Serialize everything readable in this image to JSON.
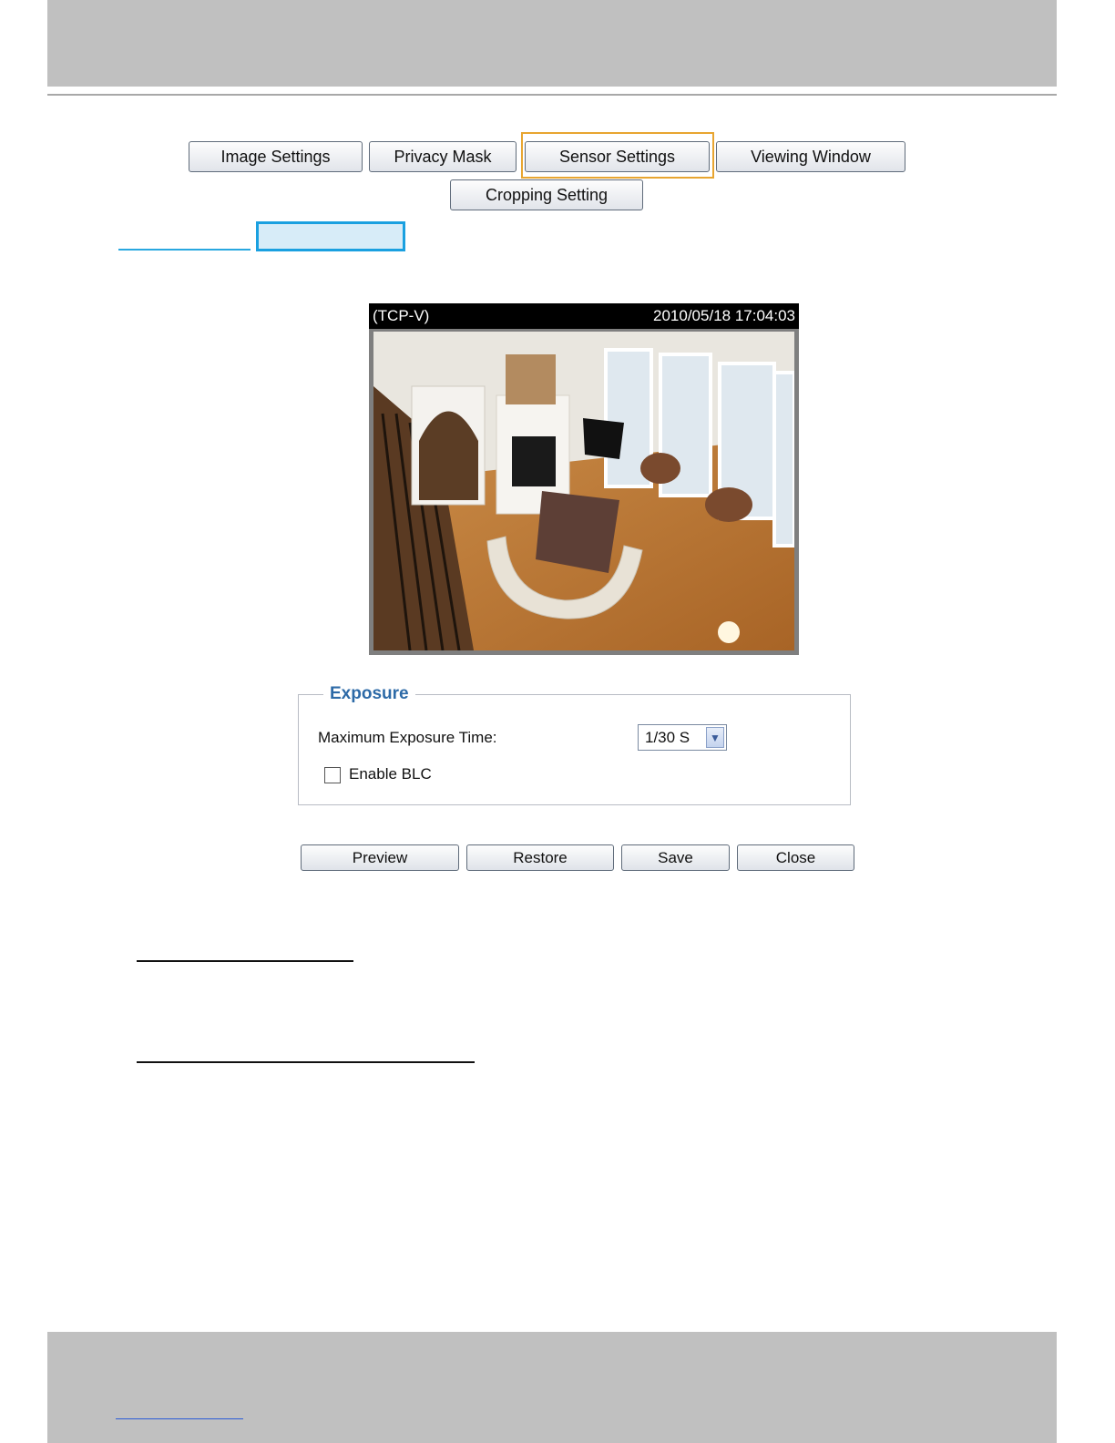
{
  "tabs": {
    "image_settings": "Image Settings",
    "privacy_mask": "Privacy Mask",
    "sensor_settings": "Sensor Settings",
    "viewing_window": "Viewing Window",
    "cropping_setting": "Cropping Setting"
  },
  "video": {
    "stream_label": "(TCP-V)",
    "timestamp": "2010/05/18 17:04:03"
  },
  "exposure": {
    "legend": "Exposure",
    "max_exposure_label": "Maximum Exposure Time:",
    "max_exposure_value": "1/30 S",
    "blc_label": "Enable BLC",
    "blc_checked": false
  },
  "actions": {
    "preview": "Preview",
    "restore": "Restore",
    "save": "Save",
    "close": "Close"
  },
  "colors": {
    "header_band": "#c0c0c0",
    "active_tab_outline": "#e8a530",
    "legend_blue": "#2d6aa7",
    "link_blue": "#29a8e0"
  }
}
